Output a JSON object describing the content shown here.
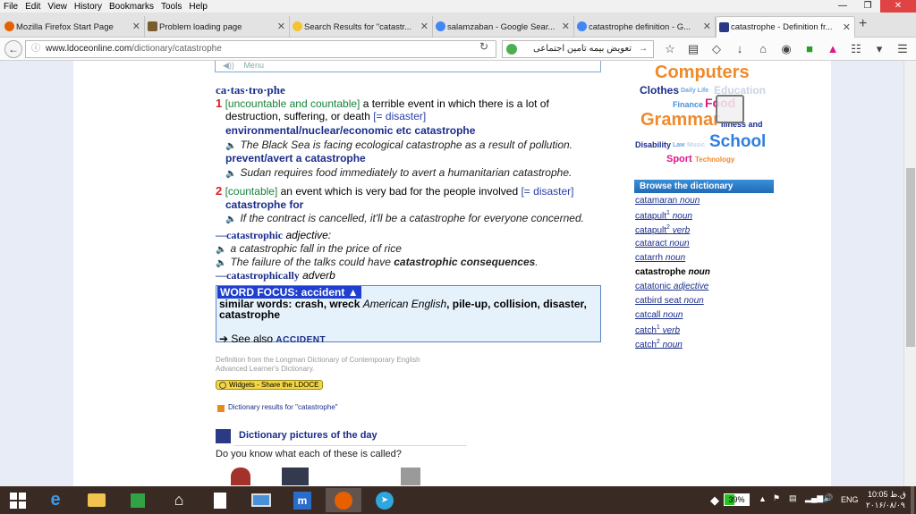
{
  "menu": [
    "File",
    "Edit",
    "View",
    "History",
    "Bookmarks",
    "Tools",
    "Help"
  ],
  "tabs": [
    {
      "title": "Mozilla Firefox Start Page",
      "icon_color": "#e66000"
    },
    {
      "title": "Problem loading page",
      "icon_color": "#7a5c2e"
    },
    {
      "title": "Search Results for \"catastr...",
      "icon_color": "#f4c330"
    },
    {
      "title": "salamzaban - Google Sear...",
      "icon_color": "#4285f4"
    },
    {
      "title": "catastrophe definition - G...",
      "icon_color": "#4285f4"
    },
    {
      "title": "catastrophe - Definition fr...",
      "icon_color": "#2c3a86"
    }
  ],
  "url": {
    "host": "www.ldoceonline.com",
    "path": "/dictionary/catastrophe"
  },
  "search_value": "تعویض بیمه تامین اجتماعی",
  "top_box_label": "Menu",
  "entry": {
    "headword": "ca·tas·tro·phe",
    "sense1": {
      "num": "1",
      "gram": "[uncountable and countable]",
      "def1": " a terrible event in which there is a lot of",
      "def2": "destruction, suffering, or death ",
      "syn": "[= disaster]",
      "coll1": "environmental/nuclear/economic etc catastrophe",
      "ex1": "The Black Sea is facing ecological catastrophe as a result of pollution.",
      "coll2": "prevent/avert a catastrophe",
      "ex2": "Sudan requires food immediately to avert a humanitarian catastrophe."
    },
    "sense2": {
      "num": "2",
      "gram": "[countable]",
      "def": " an event which is very bad for the people involved ",
      "syn": "[= disaster]",
      "coll": "catastrophe for",
      "ex": "If the contract is cancelled, it'll be a catastrophe for everyone concerned."
    },
    "deriv1": {
      "word": "—catastrophic",
      "pos": " adjective:"
    },
    "deriv1_ex1": "a catastrophic fall in the price of rice",
    "deriv1_ex2_a": "The failure of the talks could have ",
    "deriv1_ex2_b": "catastrophic consequences",
    "deriv1_ex2_c": ".",
    "deriv2": {
      "word": "—catastrophically",
      "pos": " adverb"
    }
  },
  "word_focus": {
    "title": "WORD FOCUS: accident",
    "arrow": "▲",
    "similar_label": "similar words: crash, wreck ",
    "american": "American English",
    "rest": ", pile-up, collision, disaster,",
    "last": "catastrophe",
    "see_also": "➔ See also ",
    "see_link": "ACCIDENT"
  },
  "footer": {
    "source1": "Definition from the Longman Dictionary of Contemporary English",
    "source2": "Advanced Learner's Dictionary.",
    "widgets": "Widgets - Share the LDOCE",
    "dict_results": "Dictionary results for \"catastrophe\"",
    "potd": "Dictionary pictures of the day",
    "dykw": "Do you know what each of these is called?"
  },
  "cloud": [
    {
      "text": "Computers",
      "color": "#f08a2a"
    },
    {
      "text": "Clothes",
      "color": "#1a2d8c"
    },
    {
      "text": "Daily Life",
      "color": "#6aa9e6"
    },
    {
      "text": "Education",
      "color": "#c8d4e6"
    },
    {
      "text": "Finance",
      "color": "#4a90d9"
    },
    {
      "text": "Food",
      "color": "#e0158a"
    },
    {
      "text": "Grammar",
      "color": "#f08a2a"
    },
    {
      "text": "Illness and",
      "color": "#1a2d8c"
    },
    {
      "text": "Disability",
      "color": "#1a2d8c"
    },
    {
      "text": "Law",
      "color": "#6aa9e6"
    },
    {
      "text": "Music",
      "color": "#c8d4e6"
    },
    {
      "text": "School",
      "color": "#2f7ee0"
    },
    {
      "text": "Sport",
      "color": "#e0158a"
    },
    {
      "text": "Technology",
      "color": "#f08a2a"
    }
  ],
  "browse": {
    "title": "Browse the dictionary",
    "items": [
      {
        "word": "catamaran",
        "sup": "",
        "pos": "noun"
      },
      {
        "word": "catapult",
        "sup": "1",
        "pos": "noun"
      },
      {
        "word": "catapult",
        "sup": "2",
        "pos": "verb"
      },
      {
        "word": "cataract",
        "sup": "",
        "pos": "noun"
      },
      {
        "word": "catarrh",
        "sup": "",
        "pos": "noun"
      },
      {
        "word": "catastrophe",
        "sup": "",
        "pos": "noun"
      },
      {
        "word": "catatonic",
        "sup": "",
        "pos": "adjective"
      },
      {
        "word": "catbird seat",
        "sup": "",
        "pos": "noun"
      },
      {
        "word": "catcall",
        "sup": "",
        "pos": "noun"
      },
      {
        "word": "catch",
        "sup": "1",
        "pos": "verb"
      },
      {
        "word": "catch",
        "sup": "2",
        "pos": "noun"
      }
    ]
  },
  "taskbar": {
    "battery": "39%",
    "battery_level": 0.39,
    "lang": "ENG",
    "time": "10:05 ق.ظ",
    "date": "۲۰۱۶/۰۸/۰۹"
  }
}
